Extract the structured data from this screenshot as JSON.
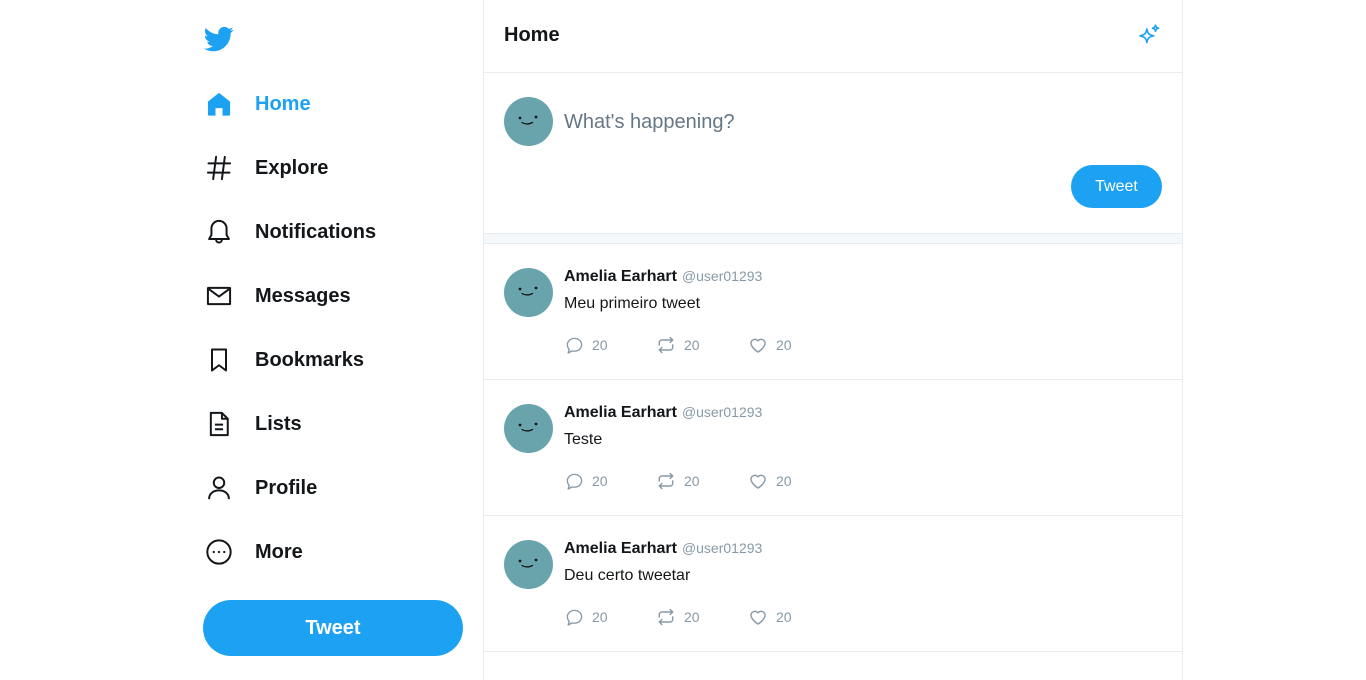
{
  "sidebar": {
    "logo_icon": "twitter-bird-icon",
    "items": [
      {
        "label": "Home",
        "icon": "home-icon",
        "active": true
      },
      {
        "label": "Explore",
        "icon": "hashtag-icon"
      },
      {
        "label": "Notifications",
        "icon": "bell-icon"
      },
      {
        "label": "Messages",
        "icon": "envelope-icon"
      },
      {
        "label": "Bookmarks",
        "icon": "bookmark-icon"
      },
      {
        "label": "Lists",
        "icon": "list-document-icon"
      },
      {
        "label": "Profile",
        "icon": "person-icon"
      },
      {
        "label": "More",
        "icon": "more-dots-icon"
      }
    ],
    "tweet_button": "Tweet"
  },
  "header": {
    "title": "Home",
    "sparkle_icon": "sparkle-icon"
  },
  "compose": {
    "placeholder": "What's happening?",
    "value": "",
    "button": "Tweet"
  },
  "tweets": [
    {
      "name": "Amelia Earhart",
      "handle": "@user01293",
      "text": "Meu primeiro tweet",
      "replies": "20",
      "retweets": "20",
      "likes": "20"
    },
    {
      "name": "Amelia Earhart",
      "handle": "@user01293",
      "text": "Teste",
      "replies": "20",
      "retweets": "20",
      "likes": "20"
    },
    {
      "name": "Amelia Earhart",
      "handle": "@user01293",
      "text": "Deu certo tweetar",
      "replies": "20",
      "retweets": "20",
      "likes": "20"
    }
  ],
  "colors": {
    "accent": "#1da1f2",
    "text": "#14171a",
    "muted": "#8899a6",
    "border": "#e6ecf0",
    "avatar": "#69a4ac"
  }
}
